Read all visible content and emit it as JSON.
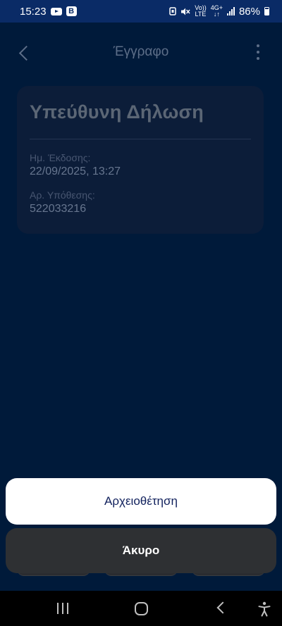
{
  "status_bar": {
    "time": "15:23",
    "volte": "Vo))",
    "lte": "LTE",
    "network": "4G+",
    "battery": "86%"
  },
  "header": {
    "title": "Έγγραφο"
  },
  "document": {
    "title": "Υπεύθυνη Δήλωση",
    "issue_date_label": "Ημ. Έκδοσης:",
    "issue_date_value": "22/09/2025, 13:27",
    "case_number_label": "Αρ. Υπόθεσης:",
    "case_number_value": "522033216"
  },
  "action_sheet": {
    "archive_label": "Αρχειοθέτηση",
    "cancel_label": "Άκυρο"
  },
  "colors": {
    "background": "#001a3a",
    "status_bar": "#0a2b66",
    "primary_text": "#10205c",
    "cancel_bg": "#2e3033"
  },
  "icons": [
    "back-icon",
    "more-icon",
    "youtube-icon",
    "b-app-icon",
    "mute-icon",
    "signal-icon",
    "battery-icon",
    "recents-icon",
    "home-icon",
    "nav-back-icon",
    "accessibility-icon"
  ]
}
